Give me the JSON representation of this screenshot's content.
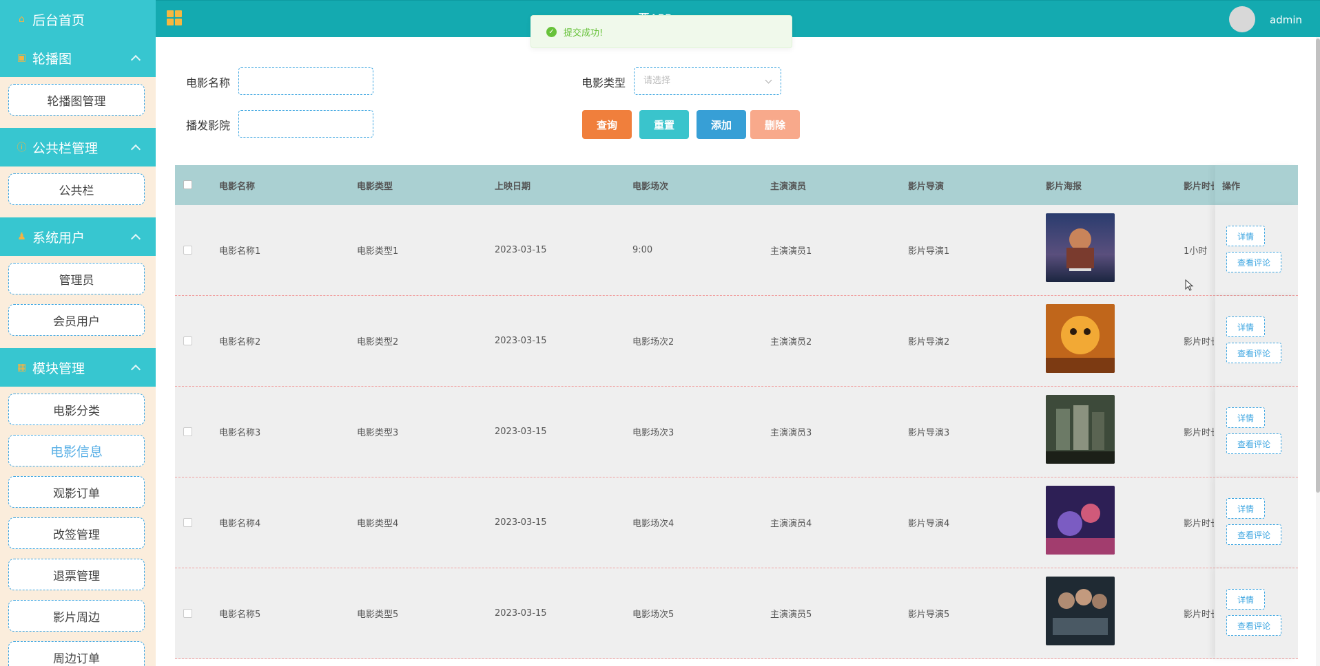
{
  "sidebar": {
    "home": "后台首页",
    "groups": [
      {
        "title": "轮播图",
        "icon": "image-icon",
        "items": [
          "轮播图管理"
        ]
      },
      {
        "title": "公共栏管理",
        "icon": "info-icon",
        "items": [
          "公共栏"
        ]
      },
      {
        "title": "系统用户",
        "icon": "user-icon",
        "items": [
          "管理员",
          "会员用户"
        ]
      },
      {
        "title": "模块管理",
        "icon": "grid-icon",
        "items": [
          "电影分类",
          "电影信息",
          "观影订单",
          "改签管理",
          "退票管理",
          "影片周边",
          "周边订单"
        ]
      }
    ],
    "active_item": "电影信息"
  },
  "header": {
    "title": "票APP",
    "username": "admin"
  },
  "toast": {
    "message": "提交成功!"
  },
  "search": {
    "name_label": "电影名称",
    "type_label": "电影类型",
    "type_placeholder": "请选择",
    "cinema_label": "播发影院",
    "buttons": {
      "query": "查询",
      "reset": "重置",
      "add": "添加",
      "delete": "删除"
    }
  },
  "table": {
    "headers": [
      "电影名称",
      "电影类型",
      "上映日期",
      "电影场次",
      "主演演员",
      "影片导演",
      "影片海报",
      "影片时长",
      "操作"
    ],
    "rows": [
      {
        "name": "电影名称1",
        "type": "电影类型1",
        "date": "2023-03-15",
        "session": "9:00",
        "actor": "主演演员1",
        "director": "影片导演1",
        "duration": "1小时"
      },
      {
        "name": "电影名称2",
        "type": "电影类型2",
        "date": "2023-03-15",
        "session": "电影场次2",
        "actor": "主演演员2",
        "director": "影片导演2",
        "duration": "影片时长"
      },
      {
        "name": "电影名称3",
        "type": "电影类型3",
        "date": "2023-03-15",
        "session": "电影场次3",
        "actor": "主演演员3",
        "director": "影片导演3",
        "duration": "影片时长"
      },
      {
        "name": "电影名称4",
        "type": "电影类型4",
        "date": "2023-03-15",
        "session": "电影场次4",
        "actor": "主演演员4",
        "director": "影片导演4",
        "duration": "影片时长"
      },
      {
        "name": "电影名称5",
        "type": "电影类型5",
        "date": "2023-03-15",
        "session": "电影场次5",
        "actor": "主演演员5",
        "director": "影片导演5",
        "duration": "影片时长"
      }
    ],
    "detail_label": "详情",
    "comments_label": "查看评论"
  },
  "colors": {
    "sidebar_bg": "#fbeddc",
    "sidebar_head": "#37c6d0",
    "topbar": "#14aab0",
    "table_head": "#aad0d2",
    "btn_query": "#f07f3c",
    "btn_reset": "#3ac4cc",
    "btn_add": "#379fd6",
    "btn_delete": "#f8a98b",
    "dashed_border": "#3aa4e0"
  }
}
